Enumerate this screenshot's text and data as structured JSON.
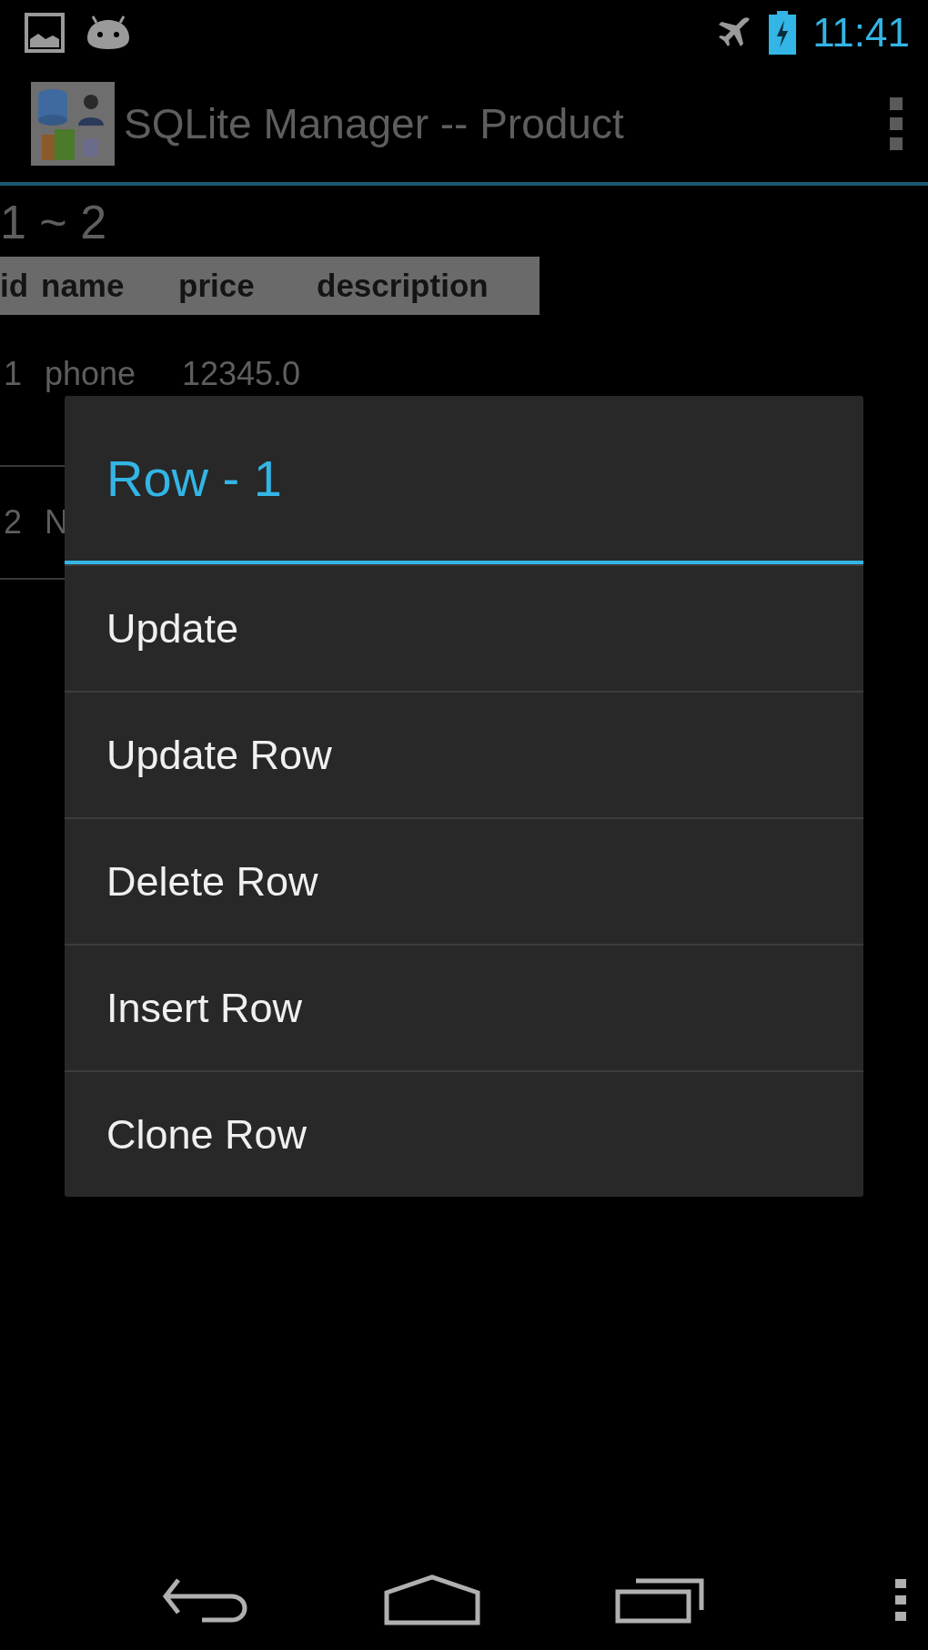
{
  "status_bar": {
    "time": "11:41"
  },
  "action_bar": {
    "title": "SQLite Manager -- Product"
  },
  "range": "1 ~ 2",
  "table": {
    "columns": [
      "id",
      "name",
      "price",
      "description"
    ],
    "rows": [
      [
        "1",
        "phone",
        "12345.0"
      ],
      [
        "2",
        "N"
      ]
    ]
  },
  "dialog": {
    "title": "Row - 1",
    "items": [
      "Update",
      "Update Row",
      "Delete Row",
      "Insert Row",
      "Clone Row"
    ]
  }
}
